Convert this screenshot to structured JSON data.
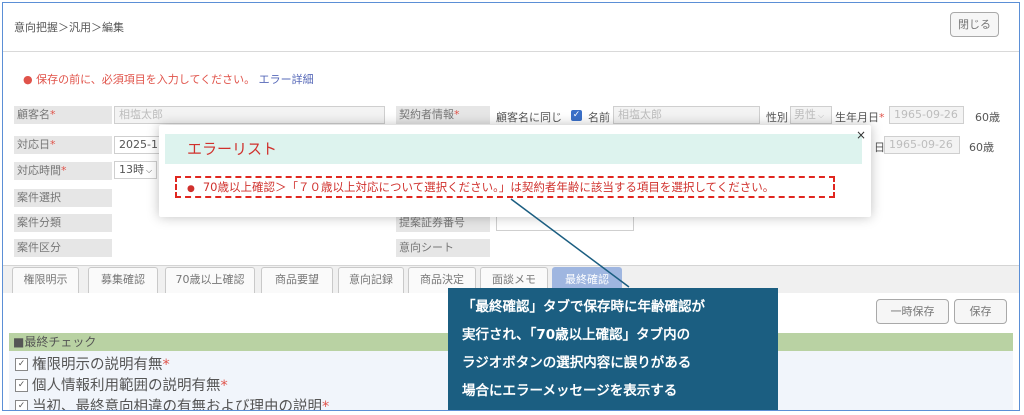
{
  "breadcrumb": "意向把握＞汎用＞編集",
  "close_button": "閉じる",
  "error_banner": {
    "bullet": "●",
    "message": "保存の前に、必須項目を入力してください。",
    "link": "エラー詳細"
  },
  "form": {
    "customer_name_label": "顧客名",
    "customer_name_value": "相塩太郎",
    "contractor_label": "契約者情報",
    "same_as_customer": "顧客名に同じ",
    "name_label": "名前",
    "contractor_name_value": "相塩太郎",
    "gender_label": "性別",
    "gender_value": "男性",
    "birthdate_label": "生年月日",
    "birthdate_value": "1965-09-26",
    "age_value": "60歳",
    "response_date_label": "対応日",
    "response_date_value": "2025-11",
    "birthdate_value_2": "1965-09-26",
    "birthdate_suffix_2": "日",
    "age_value_2": "60歳",
    "response_time_label": "対応時間",
    "response_time_value": "13時",
    "case_select_label": "案件選択",
    "case_class_label": "案件分類",
    "proposal_label": "提案証券番号",
    "case_section_label": "案件区分",
    "intent_sheet_label": "意向シート",
    "required_mark": "*"
  },
  "tabs": [
    {
      "label": "権限明示"
    },
    {
      "label": "募集確認"
    },
    {
      "label": "70歳以上確認"
    },
    {
      "label": "商品要望"
    },
    {
      "label": "意向記録"
    },
    {
      "label": "商品決定"
    },
    {
      "label": "面談メモ"
    },
    {
      "label": "最終確認"
    }
  ],
  "temp_save_button": "一時保存",
  "save_button": "保存",
  "final_check": {
    "title": "■最終チェック",
    "items": [
      {
        "label": "権限明示の説明有無"
      },
      {
        "label": "個人情報利用範囲の説明有無"
      },
      {
        "label": "当初、最終意向相違の有無および理由の説明"
      }
    ]
  },
  "error_modal": {
    "title": "エラーリスト",
    "close": "×",
    "bullet": "●",
    "message": "70歳以上確認＞「７０歳以上対応について選択ください。」は契約者年齢に該当する項目を選択してください。"
  },
  "callout": {
    "lines": [
      "「最終確認」タブで保存時に年齢確認が",
      "実行され、「70歳以上確認」タブ内の",
      "ラジオボタンの選択内容に誤りがある",
      "場合にエラーメッセージを表示する"
    ]
  },
  "colors": {
    "error_red": "#e0261f",
    "callout_bg": "#1b5e81",
    "section_green": "#b9d2a3",
    "active_tab": "#9fb6e0",
    "modal_title_bg": "#ddf3ee"
  }
}
